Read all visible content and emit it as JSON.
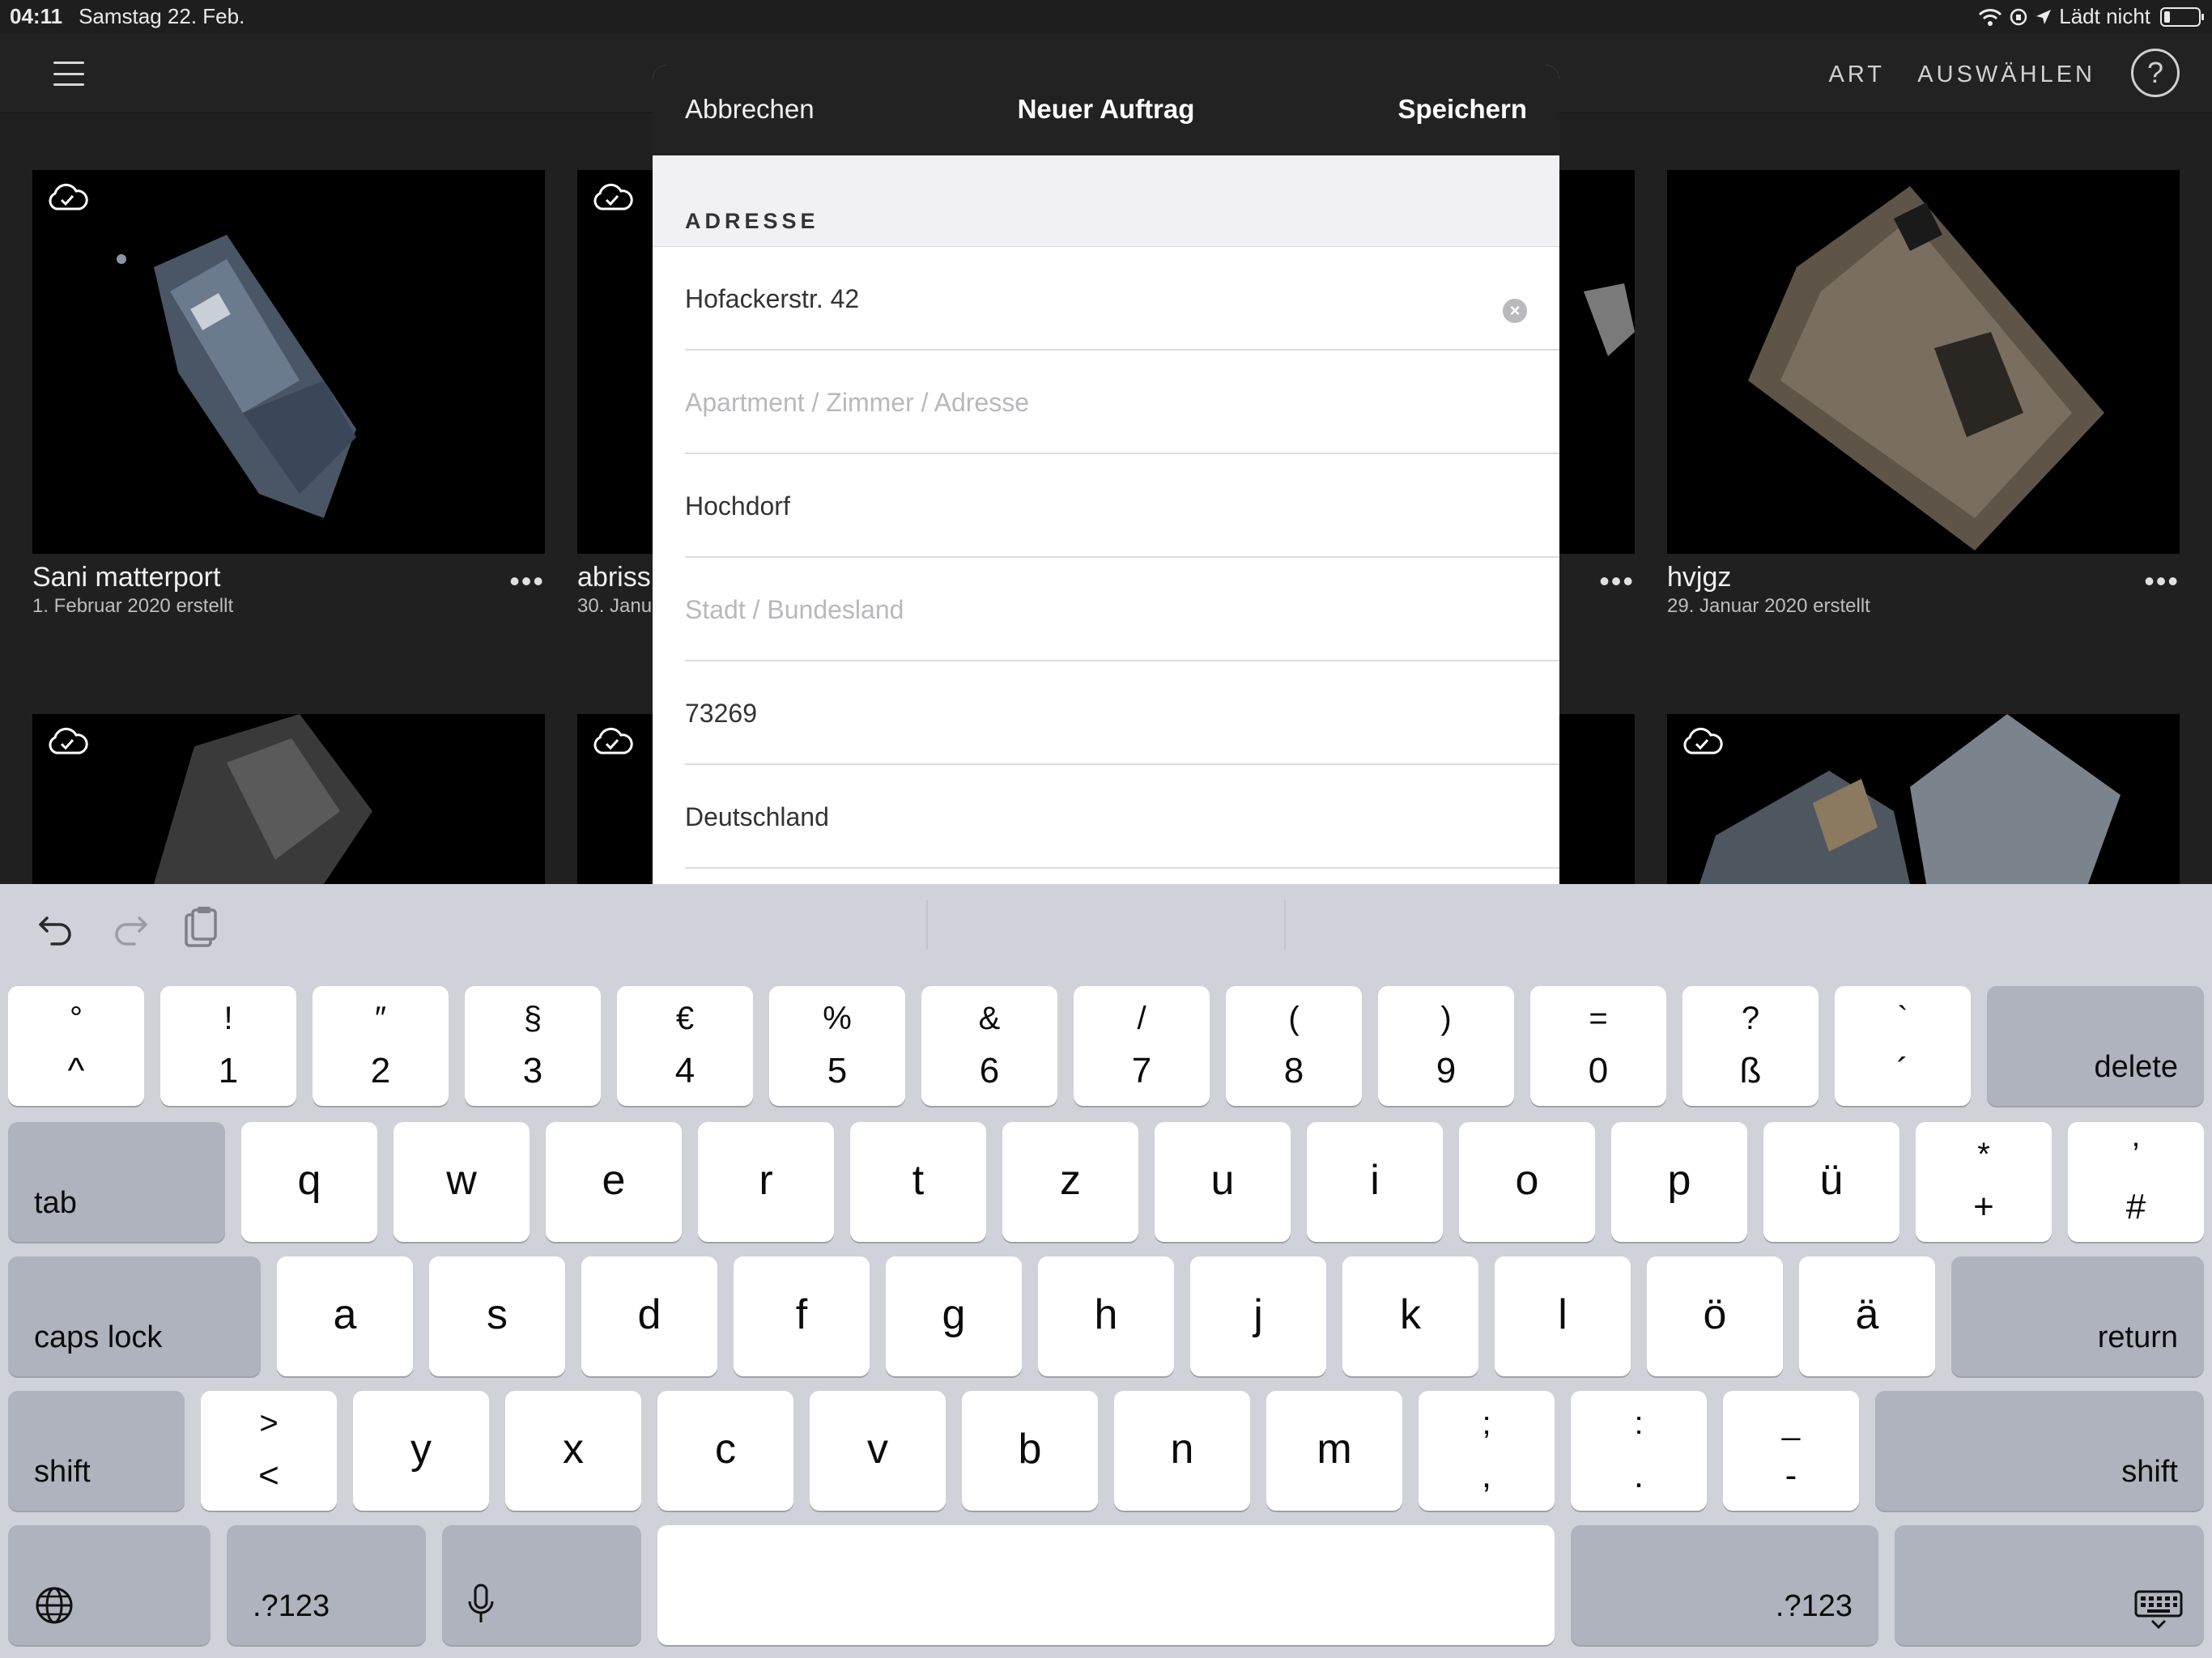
{
  "status_bar": {
    "time": "04:11",
    "date": "Samstag 22. Feb.",
    "charging": "Lädt nicht",
    "icons": [
      "wifi-icon",
      "orientation-lock-icon",
      "location-icon",
      "battery-icon"
    ]
  },
  "nav": {
    "menu_icon": "hamburger-menu-icon",
    "art": "ART",
    "select": "AUSWÄHLEN",
    "help": "?"
  },
  "cards": [
    {
      "title": "Sani matterport",
      "date": "1. Februar 2020 erstellt",
      "synced": true
    },
    {
      "title": "abriss",
      "date": "30. Janu",
      "synced": true
    },
    {
      "title": "",
      "date": "",
      "synced": true
    },
    {
      "title": "hvjgz",
      "date": "29. Januar 2020 erstellt",
      "synced": true
    },
    {
      "title": "",
      "date": "",
      "synced": true
    },
    {
      "title": "",
      "date": "",
      "synced": true
    },
    {
      "title": "",
      "date": "",
      "synced": true
    },
    {
      "title": "",
      "date": "",
      "synced": true
    }
  ],
  "more_glyph": "•••",
  "modal": {
    "cancel": "Abbrechen",
    "title": "Neuer Auftrag",
    "save": "Speichern",
    "section": "ADRESSE",
    "fields": [
      {
        "value": "Hofackerstr. 42",
        "placeholder": "",
        "focused": true
      },
      {
        "value": "",
        "placeholder": "Apartment / Zimmer / Adresse"
      },
      {
        "value": "Hochdorf",
        "placeholder": ""
      },
      {
        "value": "",
        "placeholder": "Stadt / Bundesland"
      },
      {
        "value": "73269",
        "placeholder": ""
      },
      {
        "value": "Deutschland",
        "placeholder": ""
      }
    ],
    "clear_glyph": "×"
  },
  "keyboard": {
    "toolbar": [
      "undo-icon",
      "redo-icon",
      "paste-icon"
    ],
    "row1": [
      {
        "top": "°",
        "bottom": "^"
      },
      {
        "top": "!",
        "bottom": "1"
      },
      {
        "top": "″",
        "bottom": "2"
      },
      {
        "top": "§",
        "bottom": "3"
      },
      {
        "top": "€",
        "bottom": "4"
      },
      {
        "top": "%",
        "bottom": "5"
      },
      {
        "top": "&",
        "bottom": "6"
      },
      {
        "top": "/",
        "bottom": "7"
      },
      {
        "top": "(",
        "bottom": "8"
      },
      {
        "top": ")",
        "bottom": "9"
      },
      {
        "top": "=",
        "bottom": "0"
      },
      {
        "top": "?",
        "bottom": "ß"
      },
      {
        "top": "`",
        "bottom": "´"
      }
    ],
    "delete": "delete",
    "tab": "tab",
    "row2": [
      "q",
      "w",
      "e",
      "r",
      "t",
      "z",
      "u",
      "i",
      "o",
      "p",
      "ü"
    ],
    "row2_extra": [
      {
        "top": "*",
        "bottom": "+"
      },
      {
        "top": "’",
        "bottom": "#"
      }
    ],
    "caps_lock": "caps lock",
    "row3": [
      "a",
      "s",
      "d",
      "f",
      "g",
      "h",
      "j",
      "k",
      "l",
      "ö",
      "ä"
    ],
    "return": "return",
    "shift": "shift",
    "row4_first": {
      "top": ">",
      "bottom": "<"
    },
    "row4": [
      "y",
      "x",
      "c",
      "v",
      "b",
      "n",
      "m"
    ],
    "row4_extra": [
      {
        "top": ";",
        "bottom": ","
      },
      {
        "top": ":",
        "bottom": "."
      },
      {
        "top": "_",
        "bottom": "-"
      }
    ],
    "numbers": ".?123",
    "icons": {
      "globe": "globe-icon",
      "mic": "microphone-icon",
      "hide": "keyboard-dismiss-icon"
    }
  }
}
